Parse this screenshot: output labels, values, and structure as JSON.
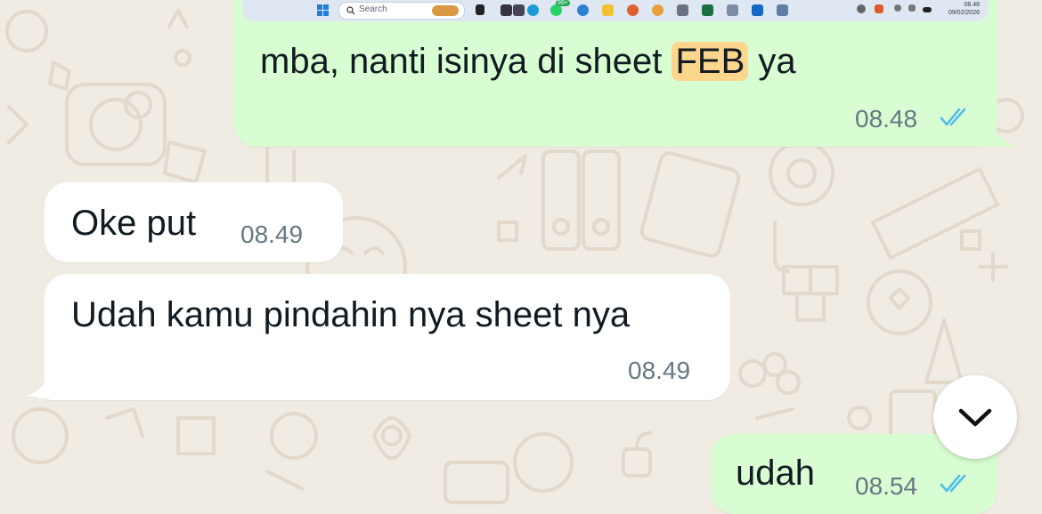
{
  "colors": {
    "wallpaper": "#f0ebe3",
    "incoming_bubble": "#ffffff",
    "outgoing_bubble": "#d9fdd3",
    "highlight": "#fbd68c",
    "read_ticks": "#53bdeb",
    "time_text": "#667781"
  },
  "taskbar": {
    "search_placeholder": "Search",
    "notification_badge": "99+",
    "clock_time": "08.48",
    "clock_date": "09/02/2026"
  },
  "messages": [
    {
      "direction": "outgoing",
      "text_before": "mba, nanti isinya di sheet ",
      "highlight": "FEB",
      "text_after": " ya",
      "time": "08.48",
      "status": "read"
    },
    {
      "direction": "incoming",
      "text": "Oke put",
      "time": "08.49"
    },
    {
      "direction": "incoming",
      "text": "Udah kamu pindahin nya sheet nya",
      "time": "08.49"
    },
    {
      "direction": "outgoing",
      "text": "udah",
      "time": "08.54",
      "status": "read"
    }
  ],
  "scroll_button": {
    "icon": "chevron-down-icon"
  }
}
